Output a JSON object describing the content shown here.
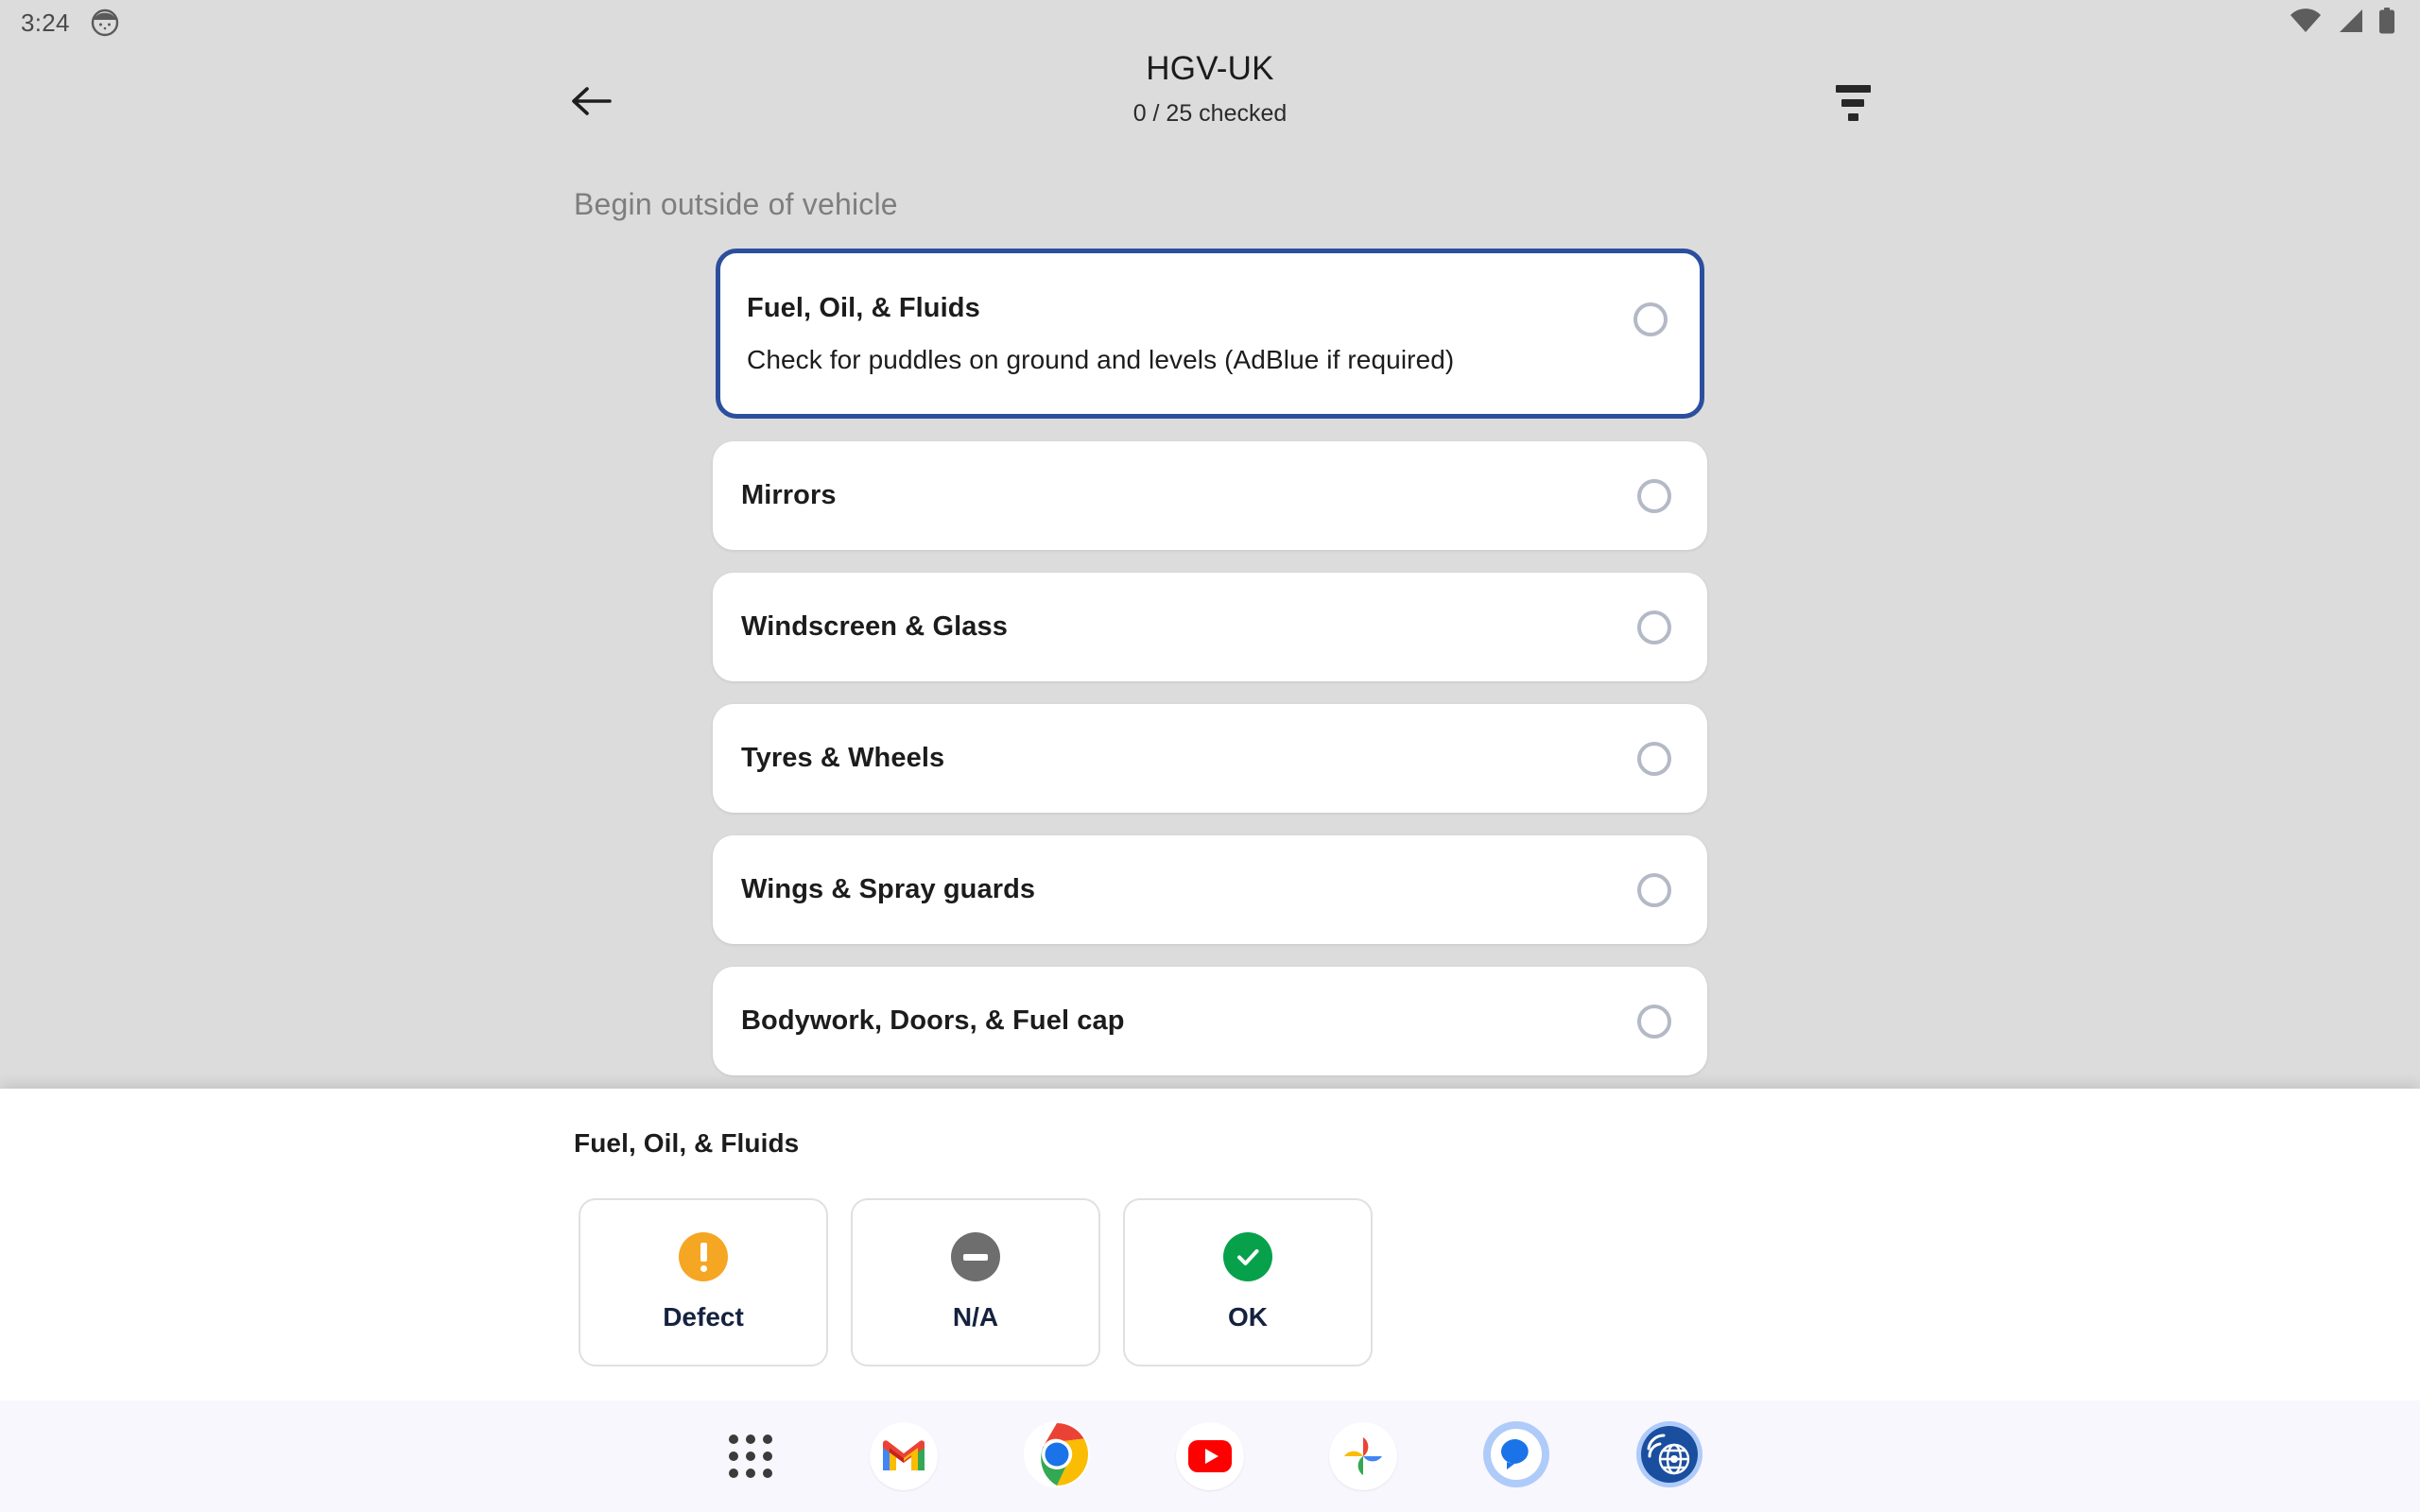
{
  "status_bar": {
    "clock": "3:24",
    "left_icons": [
      "face-avatar-icon"
    ],
    "right_icons": [
      "wifi-icon",
      "cellular-signal-icon",
      "battery-icon"
    ]
  },
  "header": {
    "back_icon": "back-arrow-icon",
    "title": "HGV-UK",
    "subtitle": "0 / 25 checked",
    "filter_icon": "filter-icon"
  },
  "list": {
    "section_label": "Begin outside of vehicle",
    "items": [
      {
        "title": "Fuel, Oil, & Fluids",
        "description": "Check for puddles on ground and levels (AdBlue if required)",
        "selected": true,
        "state": "unchecked"
      },
      {
        "title": "Mirrors",
        "description": "",
        "selected": false,
        "state": "unchecked"
      },
      {
        "title": "Windscreen & Glass",
        "description": "",
        "selected": false,
        "state": "unchecked"
      },
      {
        "title": "Tyres & Wheels",
        "description": "",
        "selected": false,
        "state": "unchecked"
      },
      {
        "title": "Wings & Spray guards",
        "description": "",
        "selected": false,
        "state": "unchecked"
      },
      {
        "title": "Bodywork, Doors, & Fuel cap",
        "description": "",
        "selected": false,
        "state": "unchecked"
      }
    ]
  },
  "bottom_sheet": {
    "title": "Fuel, Oil, & Fluids",
    "actions": [
      {
        "label": "Defect",
        "icon": "exclamation-circle-icon",
        "color": "#F5A623"
      },
      {
        "label": "N/A",
        "icon": "minus-circle-icon",
        "color": "#6E6E6E"
      },
      {
        "label": "OK",
        "icon": "check-circle-icon",
        "color": "#06A14A"
      }
    ]
  },
  "dock": {
    "items": [
      {
        "name": "app-drawer-icon",
        "label": "Apps"
      },
      {
        "name": "gmail-icon",
        "label": "Gmail"
      },
      {
        "name": "chrome-icon",
        "label": "Chrome"
      },
      {
        "name": "youtube-icon",
        "label": "YouTube"
      },
      {
        "name": "google-photos-icon",
        "label": "Photos"
      },
      {
        "name": "google-messages-icon",
        "label": "Messages"
      },
      {
        "name": "telematics-globe-icon",
        "label": "Telematics"
      }
    ]
  },
  "colors": {
    "page_background": "#dcdcdc",
    "card_background": "#ffffff",
    "selected_border": "#2b4f9e",
    "radio_outline": "#b3b9c6",
    "section_label": "#7e7e7e",
    "action_label": "#15223f",
    "dock_background": "#f8f7fe"
  }
}
